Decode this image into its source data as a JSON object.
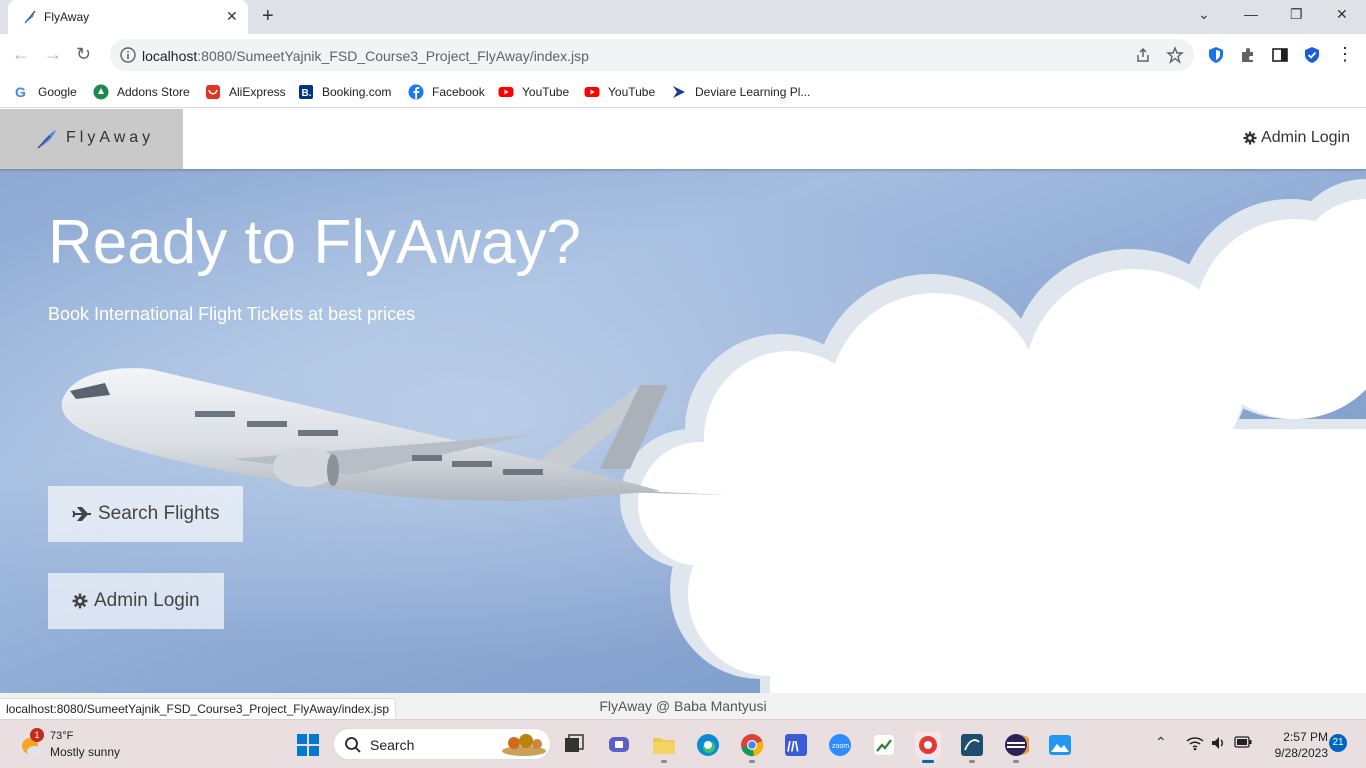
{
  "browser": {
    "tab_title": "FlyAway",
    "url_host": "localhost",
    "url_rest": ":8080/SumeetYajnik_FSD_Course3_Project_FlyAway/index.jsp",
    "status_url": "localhost:8080/SumeetYajnik_FSD_Course3_Project_FlyAway/index.jsp"
  },
  "bookmarks": [
    {
      "label": "Google",
      "icon": "google-icon"
    },
    {
      "label": "Addons Store",
      "icon": "addons-store-icon"
    },
    {
      "label": "AliExpress",
      "icon": "aliexpress-icon"
    },
    {
      "label": "Booking.com",
      "icon": "booking-icon"
    },
    {
      "label": "Facebook",
      "icon": "facebook-icon"
    },
    {
      "label": "YouTube",
      "icon": "youtube-icon"
    },
    {
      "label": "YouTube",
      "icon": "youtube-icon"
    },
    {
      "label": "Deviare Learning Pl...",
      "icon": "deviare-icon"
    }
  ],
  "site": {
    "brand": "FlyAway",
    "nav_admin": "Admin Login",
    "hero_title": "Ready to FlyAway?",
    "hero_subtitle": "Book International Flight Tickets at best prices",
    "search_button": "Search Flights",
    "admin_button": "Admin Login",
    "footer": "FlyAway @ Baba Mantyusi"
  },
  "taskbar": {
    "weather_temp": "73°F",
    "weather_desc": "Mostly sunny",
    "weather_badge": "1",
    "search_label": "Search",
    "time": "2:57 PM",
    "date": "9/28/2023",
    "notifications": "21"
  },
  "colors": {
    "hero_blue": "#8eaad3",
    "brand_box": "#c9c9c9",
    "taskbar": "#eadfe0"
  }
}
